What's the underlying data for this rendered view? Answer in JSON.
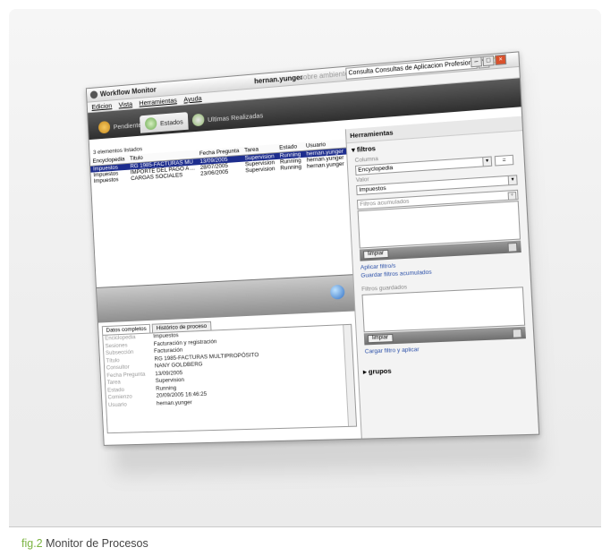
{
  "window": {
    "app_title": "Workflow Monitor",
    "user": "hernan.yunger",
    "user_suffix": "sobre ambiente",
    "company": "Consulta Consultas de Aplicacion Profesional"
  },
  "menu": [
    "Edicion",
    "Vista",
    "Herramientas",
    "Ayuda"
  ],
  "tabs": [
    {
      "label": "Pendientes",
      "active": false
    },
    {
      "label": "Estados",
      "active": true
    },
    {
      "label": "Ultimas Realizadas",
      "active": false
    }
  ],
  "grid": {
    "count_text": "3 elementos listados",
    "columns": [
      "Encyclopedia",
      "Titulo",
      "Fecha Pregunta",
      "Tarea",
      "Estado",
      "Usuario"
    ],
    "rows": [
      [
        "Impuestos",
        "RG 1985-FACTURAS MU",
        "13/09/2005",
        "Supervision",
        "Running",
        "hernan.yunger"
      ],
      [
        "Impuestos",
        "IMPORTE DEL PAGO A ...",
        "28/07/2005",
        "Supervision",
        "Running",
        "hernan.yunger"
      ],
      [
        "Impuestos",
        "CARGAS SOCIALES",
        "23/06/2005",
        "Supervision",
        "Running",
        "hernan.yunger"
      ]
    ]
  },
  "detail": {
    "tabs": [
      "Datos completos",
      "Histórico de proceso"
    ],
    "rows": [
      {
        "k": "Enciclopedia",
        "v": "Impuestos"
      },
      {
        "k": "Sesiones",
        "v": "Facturación y registración"
      },
      {
        "k": "Subsección",
        "v": "Facturación"
      },
      {
        "k": "Título",
        "v": "RG 1985-FACTURAS MULTIPROPÓSITO"
      },
      {
        "k": "Consultor",
        "v": "NANY GOLDBERG"
      },
      {
        "k": "Fecha Pregunta",
        "v": "13/09/2005"
      },
      {
        "k": "Tarea",
        "v": "Supervision"
      },
      {
        "k": "Estado",
        "v": "Running"
      },
      {
        "k": "Comienzo",
        "v": "20/09/2005 16:46:25"
      },
      {
        "k": "Usuario",
        "v": "hernan.yunger"
      }
    ]
  },
  "tools": {
    "title": "Herramientas",
    "filters_label": "filtros",
    "column_label": "Columna",
    "column_value": "Encyclopedia",
    "operator": "=",
    "value_label": "Valor",
    "value_value": "Impuestos",
    "accumulated_label": "Filtros acumulados",
    "clear_label": "limpiar",
    "apply_link": "Aplicar filtro/s",
    "save_link": "Guardar filtros acumulados",
    "saved_label": "Filtros guardados",
    "clear_label2": "limpiar",
    "load_link": "Cargar filtro y aplicar",
    "groups_label": "grupos"
  },
  "caption": {
    "fig": "fig.2",
    "text": " Monitor de Procesos"
  },
  "colors": {
    "accent": "#7bb441",
    "selection": "#1d2d8e",
    "toolbar": "#3a3a3a"
  }
}
